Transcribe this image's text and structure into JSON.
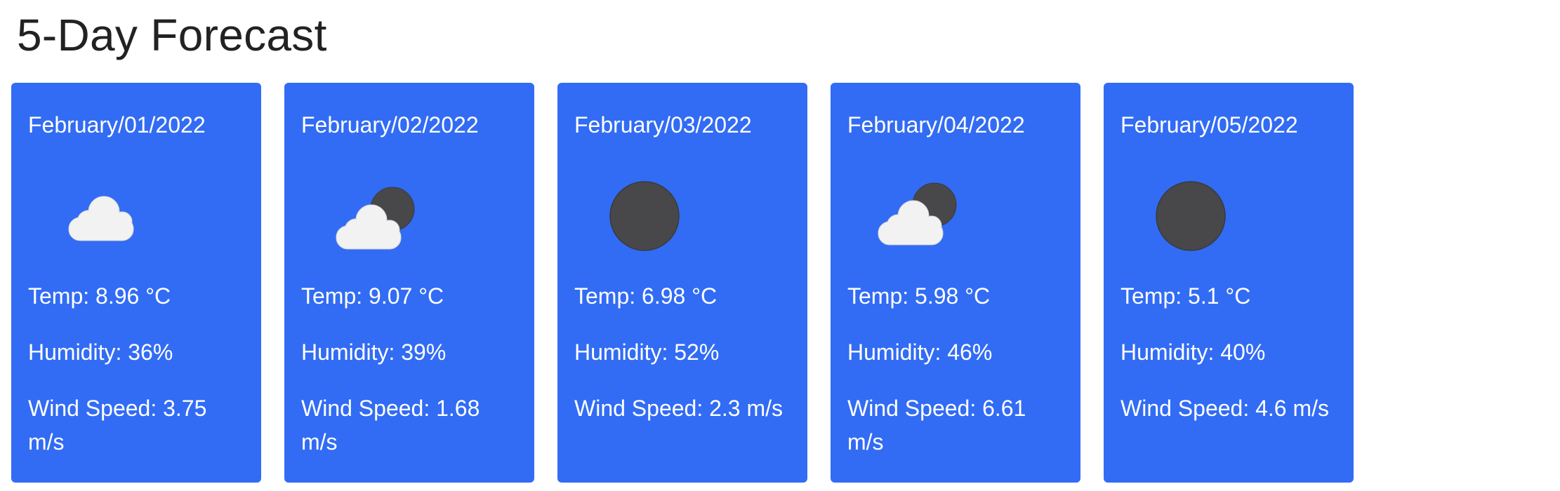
{
  "page": {
    "title": "5-Day Forecast"
  },
  "colors": {
    "card_background": "#326cf4",
    "cloud": "#f2f2f2",
    "moon": "#48484a"
  },
  "forecast": [
    {
      "date": "February/01/2022",
      "icon": "cloud-icon",
      "temp": "Temp: 8.96 °C",
      "humidity": "Humidity: 36%",
      "wind": "Wind Speed: 3.75 m/s"
    },
    {
      "date": "February/02/2022",
      "icon": "cloud-moon-icon",
      "temp": "Temp: 9.07 °C",
      "humidity": "Humidity: 39%",
      "wind": "Wind Speed: 1.68 m/s"
    },
    {
      "date": "February/03/2022",
      "icon": "moon-icon",
      "temp": "Temp: 6.98 °C",
      "humidity": "Humidity: 52%",
      "wind": "Wind Speed: 2.3 m/s"
    },
    {
      "date": "February/04/2022",
      "icon": "cloud-moon-icon",
      "temp": "Temp: 5.98 °C",
      "humidity": "Humidity: 46%",
      "wind": "Wind Speed: 6.61 m/s"
    },
    {
      "date": "February/05/2022",
      "icon": "moon-icon",
      "temp": "Temp: 5.1 °C",
      "humidity": "Humidity: 40%",
      "wind": "Wind Speed: 4.6 m/s"
    }
  ]
}
